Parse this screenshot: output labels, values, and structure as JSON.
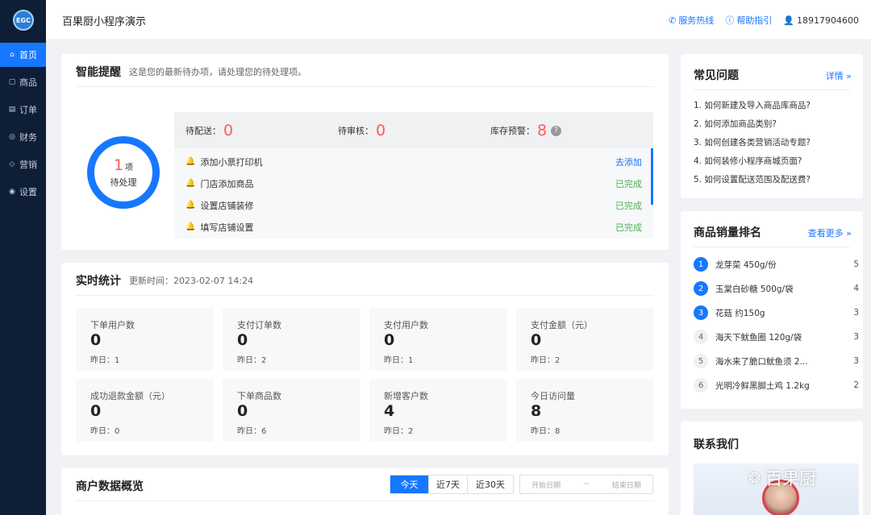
{
  "sidebar": {
    "logo": "EGC",
    "items": [
      {
        "label": "首页",
        "icon": "home-icon",
        "glyph": "⌂"
      },
      {
        "label": "商品",
        "icon": "bag-icon",
        "glyph": "▢"
      },
      {
        "label": "订单",
        "icon": "order-icon",
        "glyph": "▤"
      },
      {
        "label": "财务",
        "icon": "finance-icon",
        "glyph": "◎"
      },
      {
        "label": "营销",
        "icon": "tag-icon",
        "glyph": "◇"
      },
      {
        "label": "设置",
        "icon": "settings-icon",
        "glyph": "◉"
      }
    ]
  },
  "topbar": {
    "title": "百果厨小程序演示",
    "hotline": "服务热线",
    "help": "帮助指引",
    "user": "18917904600"
  },
  "reminder": {
    "title": "智能提醒",
    "subtitle": "这是您的最新待办项，请处理您的待处理项。",
    "donut_count": "1",
    "donut_unit": "项",
    "donut_label": "待处理",
    "stats": [
      {
        "label": "待配送：",
        "value": "0"
      },
      {
        "label": "待审核：",
        "value": "0"
      },
      {
        "label": "库存预警：",
        "value": "8"
      }
    ],
    "todos": [
      {
        "label": "添加小票打印机",
        "action": "去添加",
        "done": false,
        "bell_color": "#ff4d4f"
      },
      {
        "label": "门店添加商品",
        "action": "已完成",
        "done": true,
        "bell_color": "#52c41a"
      },
      {
        "label": "设置店铺装修",
        "action": "已完成",
        "done": true,
        "bell_color": "#52c41a"
      },
      {
        "label": "填写店铺设置",
        "action": "已完成",
        "done": true,
        "bell_color": "#52c41a"
      }
    ]
  },
  "realtime": {
    "title": "实时统计",
    "updated": "更新时间：2023-02-07 14:24",
    "metrics": [
      {
        "label": "下单用户数",
        "value": "0",
        "yesterday": "昨日：1"
      },
      {
        "label": "支付订单数",
        "value": "0",
        "yesterday": "昨日：2"
      },
      {
        "label": "支付用户数",
        "value": "0",
        "yesterday": "昨日：1"
      },
      {
        "label": "支付金额（元）",
        "value": "0",
        "yesterday": "昨日：2"
      },
      {
        "label": "成功退款金额（元）",
        "value": "0",
        "yesterday": "昨日：0"
      },
      {
        "label": "下单商品数",
        "value": "0",
        "yesterday": "昨日：6"
      },
      {
        "label": "新增客户数",
        "value": "4",
        "yesterday": "昨日：2"
      },
      {
        "label": "今日访问量",
        "value": "8",
        "yesterday": "昨日：8"
      }
    ]
  },
  "overview": {
    "title": "商户数据概览",
    "tabs": [
      "今天",
      "近7天",
      "近30天"
    ],
    "start_placeholder": "开始日期",
    "range_sep": "~",
    "end_placeholder": "结束日期"
  },
  "faq": {
    "title": "常见问题",
    "more": "详情 »",
    "items": [
      "1. 如何新建及导入商品库商品?",
      "2. 如何添加商品类别?",
      "3. 如何创建各类营销活动专题?",
      "4. 如何装修小程序商城页面?",
      "5. 如何设置配送范围及配送费?"
    ]
  },
  "ranking": {
    "title": "商品销量排名",
    "more": "查看更多 »",
    "items": [
      {
        "rank": "1",
        "name": "龙芽菜 450g/份",
        "count": "5"
      },
      {
        "rank": "2",
        "name": "玉棠白砂糖 500g/袋",
        "count": "4"
      },
      {
        "rank": "3",
        "name": "花菇 约150g",
        "count": "3"
      },
      {
        "rank": "4",
        "name": "海天下鱿鱼圈 120g/袋",
        "count": "3"
      },
      {
        "rank": "5",
        "name": "海水来了脆口鱿鱼须 2...",
        "count": "3"
      },
      {
        "rank": "6",
        "name": "光明冷鲜黑脚土鸡 1.2kg",
        "count": "2"
      }
    ]
  },
  "contact": {
    "title": "联系我们"
  },
  "watermark": "百果厨",
  "colors": {
    "accent": "#1677ff",
    "sidebar_bg": "#0e1e36",
    "alert_red": "#ff5a5a",
    "done_green": "#4caf50"
  }
}
